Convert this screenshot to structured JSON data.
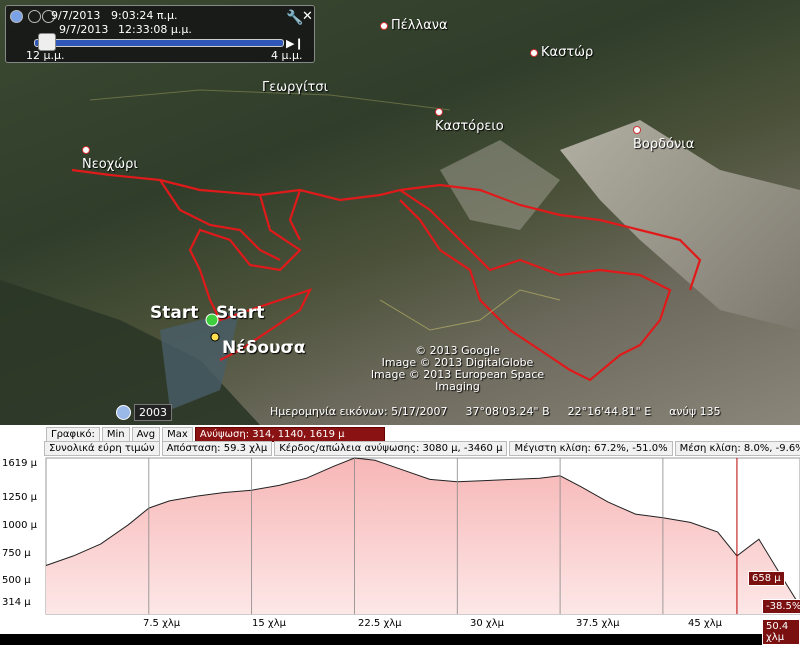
{
  "time_slider": {
    "date_top": "9/7/2013",
    "time_top": "9:03:24 π.μ.",
    "date_bottom": "9/7/2013",
    "time_bottom": "12:33:08 μ.μ.",
    "left_label": "12 μ.μ.",
    "right_label": "4 μ.μ."
  },
  "map": {
    "places": [
      {
        "name": "Πέλλανα",
        "big": false
      },
      {
        "name": "Γεωργίτσι",
        "big": false
      },
      {
        "name": "Καστώρ",
        "big": false
      },
      {
        "name": "Καστόρειο",
        "big": false
      },
      {
        "name": "Βορδόνια",
        "big": false
      },
      {
        "name": "Νεοχώρι",
        "big": false
      },
      {
        "name": "Νέδουσα",
        "big": true
      }
    ],
    "start_labels": [
      "Start",
      "Start"
    ],
    "credits": [
      "© 2013 Google",
      "Image © 2013 DigitalGlobe",
      "Image © 2013 European Space Imaging"
    ],
    "historical_year": "2003",
    "status": {
      "image_date": "Ημερομηνία εικόνων: 5/17/2007",
      "lat": "37°08'03.24\" Β",
      "lon": "22°16'44.81\" Ε",
      "elev": "ανύψ 135"
    },
    "track_color": "#e01a1a"
  },
  "profile": {
    "row1": {
      "graph_label": "Γραφικό:",
      "min": "Min",
      "avg": "Avg",
      "max": "Max",
      "elevation": "Ανύψωση: 314, 1140, 1619 μ"
    },
    "row2": {
      "range": "Συνολικά εύρη τιμών",
      "distance": "Απόσταση: 59.3 χλμ",
      "gain_loss": "Κέρδος/απώλεια ανύψωσης: 3080 μ, -3460 μ",
      "max_slope": "Μέγιστη κλίση: 67.2%, -51.0%",
      "avg_slope": "Μέση κλίση: 8.0%, -9.6%"
    },
    "y_ticks": [
      "1619 μ",
      "1250 μ",
      "1000 μ",
      "750 μ",
      "500 μ",
      "314 μ"
    ],
    "x_ticks": [
      "7.5 χλμ",
      "15 χλμ",
      "22.5 χλμ",
      "30 χλμ",
      "37.5 χλμ",
      "45 χλμ",
      "50.4 χλμ"
    ],
    "cursor_elevation": "658 μ",
    "cursor_slope": "-38.5%"
  },
  "chart_data": {
    "type": "area",
    "xlabel": "",
    "ylabel": "",
    "ylim": [
      314,
      1619
    ],
    "x": [
      0,
      2,
      4,
      6,
      7.5,
      9,
      11,
      13,
      15,
      17,
      19,
      21,
      22.5,
      24,
      26,
      28,
      30,
      32,
      34,
      36,
      37.5,
      39,
      41,
      43,
      45,
      47,
      49,
      50.4,
      52,
      53.5,
      55
    ],
    "values": [
      720,
      800,
      900,
      1060,
      1200,
      1260,
      1300,
      1330,
      1350,
      1390,
      1450,
      1550,
      1619,
      1600,
      1520,
      1440,
      1420,
      1430,
      1440,
      1450,
      1470,
      1380,
      1250,
      1150,
      1120,
      1080,
      1000,
      800,
      940,
      658,
      380
    ]
  }
}
